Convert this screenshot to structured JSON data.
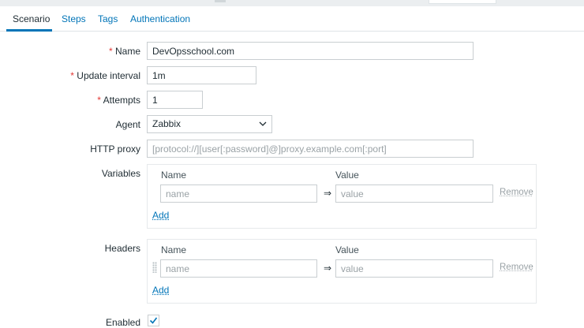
{
  "tabs": [
    {
      "label": "Scenario"
    },
    {
      "label": "Steps"
    },
    {
      "label": "Tags"
    },
    {
      "label": "Authentication"
    }
  ],
  "form": {
    "required_mark": "*",
    "name": {
      "label": "Name",
      "value": "DevOpsschool.com"
    },
    "update_interval": {
      "label": "Update interval",
      "value": "1m"
    },
    "attempts": {
      "label": "Attempts",
      "value": "1"
    },
    "agent": {
      "label": "Agent",
      "value": "Zabbix"
    },
    "http_proxy": {
      "label": "HTTP proxy",
      "placeholder": "[protocol://][user[:password]@]proxy.example.com[:port]"
    },
    "variables": {
      "label": "Variables",
      "col_name": "Name",
      "col_value": "Value",
      "row": {
        "name_placeholder": "name",
        "value_placeholder": "value",
        "arrow": "⇒",
        "remove": "Remove"
      },
      "add": "Add"
    },
    "headers": {
      "label": "Headers",
      "col_name": "Name",
      "col_value": "Value",
      "row": {
        "name_placeholder": "name",
        "value_placeholder": "value",
        "arrow": "⇒",
        "remove": "Remove"
      },
      "add": "Add"
    },
    "enabled": {
      "label": "Enabled",
      "checked": true
    }
  },
  "colors": {
    "link": "#0275b8",
    "required": "#e33734"
  }
}
